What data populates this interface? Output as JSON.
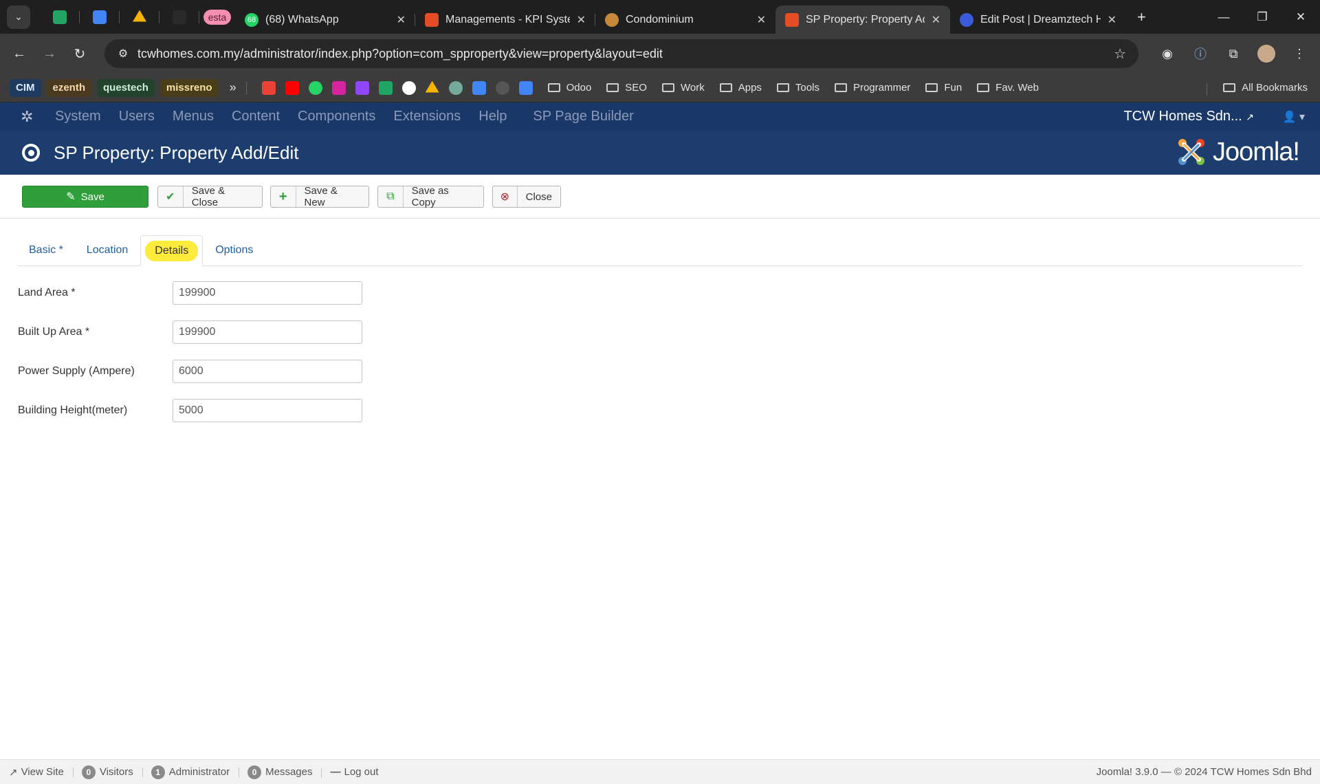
{
  "browser": {
    "pinned": [
      {
        "name": "google-sheets-icon",
        "color": "#23a566"
      },
      {
        "name": "google-calendar-icon",
        "color": "#4285f4"
      },
      {
        "name": "google-drive-icon",
        "color": "#f4b400"
      },
      {
        "name": "blank-pinned-icon",
        "color": "#2a2a2a"
      }
    ],
    "esta_label": "esta",
    "tabs": [
      {
        "title": "(68) WhatsApp",
        "fav_color": "#25d366",
        "fav_text": "68",
        "close": "✕"
      },
      {
        "title": "Managements - KPI System",
        "fav_color": "#e44d26",
        "fav_text": "",
        "close": "✕"
      },
      {
        "title": "Condominium",
        "fav_color": "#c7883a",
        "fav_text": "",
        "close": "✕"
      },
      {
        "title": "SP Property: Property Add/Edit",
        "fav_color": "#e44d26",
        "fav_text": "",
        "close": "✕"
      },
      {
        "title": "Edit Post | Dreamztech Help",
        "fav_color": "#3b5bdb",
        "fav_text": "",
        "close": "✕"
      }
    ],
    "new_tab": "+",
    "url": "tcwhomes.com.my/administrator/index.php?option=com_spproperty&view=property&layout=edit",
    "bookmark_tags": [
      {
        "label": "CIM",
        "bg": "#1e3a5f",
        "fg": "#dce9ff"
      },
      {
        "label": "ezenth",
        "bg": "#4a3a22",
        "fg": "#f3d9a8"
      },
      {
        "label": "questech",
        "bg": "#24432f",
        "fg": "#c9f0d2"
      },
      {
        "label": "missreno",
        "bg": "#4a3d1a",
        "fg": "#f6e2a4"
      }
    ],
    "bookmark_more": "»",
    "bookmark_icons": [
      {
        "name": "gmail-icon",
        "color": "#ea4335"
      },
      {
        "name": "youtube-icon",
        "color": "#ff0000"
      },
      {
        "name": "whatsapp-icon",
        "color": "#25d366"
      },
      {
        "name": "instagram-icon",
        "color": "#d6249f"
      },
      {
        "name": "twitch-icon",
        "color": "#9146ff"
      },
      {
        "name": "sheets-icon",
        "color": "#23a566"
      },
      {
        "name": "google-icon",
        "color": "#ffffff"
      },
      {
        "name": "drive-icon",
        "color": "#f4b400"
      },
      {
        "name": "chatgpt-icon",
        "color": "#74aa9c"
      },
      {
        "name": "translate-icon",
        "color": "#4285f4"
      },
      {
        "name": "clock-icon",
        "color": "#555555"
      },
      {
        "name": "calendar-icon",
        "color": "#4285f4"
      }
    ],
    "bookmark_folders": [
      "Odoo",
      "SEO",
      "Work",
      "Apps",
      "Tools",
      "Programmer",
      "Fun",
      "Fav. Web"
    ],
    "all_bookmarks": "All Bookmarks"
  },
  "joomla": {
    "menu": [
      "System",
      "Users",
      "Menus",
      "Content",
      "Components",
      "Extensions",
      "Help",
      "SP Page Builder"
    ],
    "site_name": "TCW Homes Sdn...",
    "page_title": "SP Property: Property Add/Edit",
    "logo_text": "Joomla!",
    "buttons": {
      "save": "Save",
      "save_close": "Save & Close",
      "save_new": "Save & New",
      "save_copy": "Save as Copy",
      "close": "Close"
    },
    "tabs": [
      "Basic *",
      "Location",
      "Details",
      "Options"
    ],
    "active_tab": "Details",
    "fields": [
      {
        "label": "Land Area *",
        "value": "199900"
      },
      {
        "label": "Built Up Area *",
        "value": "199900"
      },
      {
        "label": "Power Supply (Ampere)",
        "value": "6000"
      },
      {
        "label": "Building Height(meter)",
        "value": "5000"
      }
    ],
    "status": {
      "view_site": "View Site",
      "visitors_count": "0",
      "visitors": "Visitors",
      "admin_count": "1",
      "admin": "Administrator",
      "messages_count": "0",
      "messages": "Messages",
      "logout": "Log out",
      "version": "Joomla! 3.9.0  —  © 2024 TCW Homes Sdn Bhd"
    }
  },
  "colors": {
    "nav_bg": "#1a3867",
    "header_bg": "#1c3d6e",
    "save_green": "#2f9f3a",
    "highlight": "#ffeb3b"
  }
}
